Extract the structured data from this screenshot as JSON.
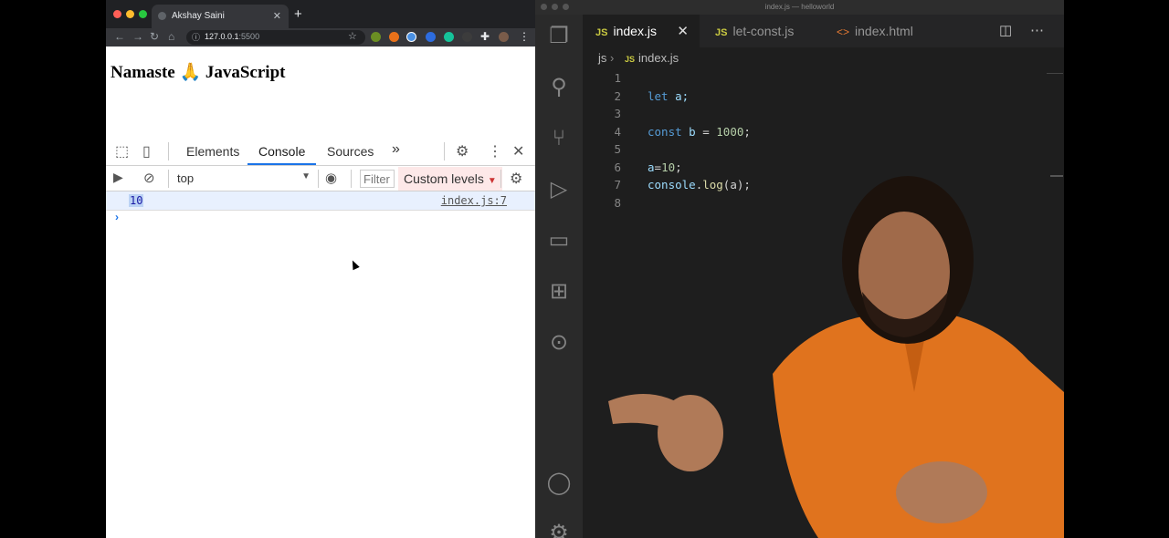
{
  "browser": {
    "tab_title": "Akshay Saini",
    "url_host": "127.0.0.1",
    "url_port": ":5500",
    "page_heading": "Namaste 🙏 JavaScript"
  },
  "devtools": {
    "tabs": [
      "Elements",
      "Console",
      "Sources"
    ],
    "more_tabs": "»",
    "context": "top",
    "filter_placeholder": "Filter",
    "levels": "Custom levels",
    "log_value": "10",
    "log_source": "index.js:7",
    "prompt": "›"
  },
  "vscode": {
    "window_title": "index.js — helloworld",
    "tabs": [
      {
        "badge": "JS",
        "label": "index.js"
      },
      {
        "badge": "JS",
        "label": "let-const.js"
      },
      {
        "badge": "<>",
        "label": "index.html"
      }
    ],
    "breadcrumb": {
      "folder": "js",
      "file_badge": "JS",
      "file": "index.js"
    },
    "line_numbers": [
      "1",
      "2",
      "3",
      "4",
      "5",
      "6",
      "7",
      "8"
    ],
    "code": {
      "l2_kw": "let",
      "l2_rest": " a;",
      "l4_kw": "const",
      "l4_var": " b",
      "l4_op": " = ",
      "l4_num": "1000",
      "l4_end": ";",
      "l6_var": "a",
      "l6_op": "=",
      "l6_num": "10",
      "l6_end": ";",
      "l7_obj": "console",
      "l7_dot": ".",
      "l7_fn": "log",
      "l7_args": "(a);"
    }
  },
  "colors": {
    "vscode_bg": "#1e1e1e",
    "keyword": "#569cd6",
    "number": "#b5cea8",
    "devtools_accent": "#1a73e8"
  }
}
